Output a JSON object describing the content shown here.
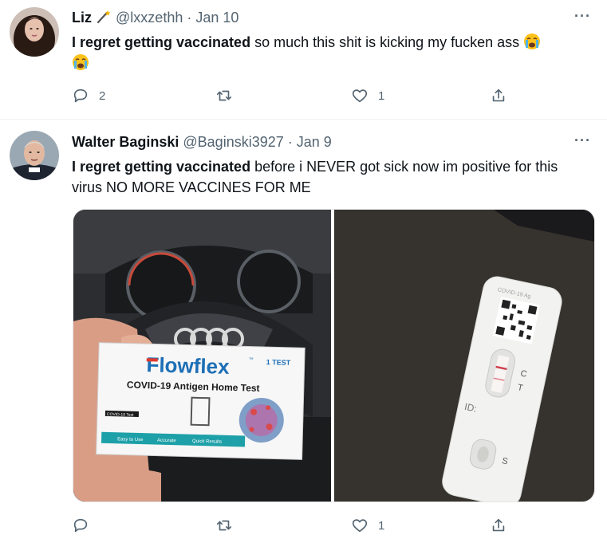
{
  "tweets": [
    {
      "name": "Liz",
      "handle": "@lxxzethh",
      "date": "Jan 10",
      "text_bold": "I regret getting vaccinated",
      "text_rest": " so much this shit is kicking my fucken ass",
      "reply_count": "2",
      "retweet_count": "",
      "like_count": "1"
    },
    {
      "name": "Walter Baginski",
      "handle": "@Baginski3927",
      "date": "Jan 9",
      "text_bold": "I regret getting vaccinated",
      "text_rest": " before i NEVER got sick now im positive for this virus NO MORE VACCINES FOR ME",
      "reply_count": "",
      "retweet_count": "",
      "like_count": "1",
      "media": {
        "box_brand": "Flowflex",
        "box_tm": "™",
        "box_count": "1 TEST",
        "box_title": "COVID-19 Antigen Home Test",
        "box_tag": "COVID-19 Test",
        "box_feature_1": "Easy to Use",
        "box_feature_2": "Accurate",
        "box_feature_3": "Quick Results",
        "cassette_label": "COVID-19 Ag",
        "cassette_c": "C",
        "cassette_t": "T",
        "cassette_id": "ID:",
        "cassette_s": "S"
      }
    }
  ],
  "more_glyph": "···",
  "icons": [
    "emoji-crying-icon",
    "reply-icon",
    "retweet-icon",
    "like-icon",
    "share-icon",
    "more-icon"
  ]
}
